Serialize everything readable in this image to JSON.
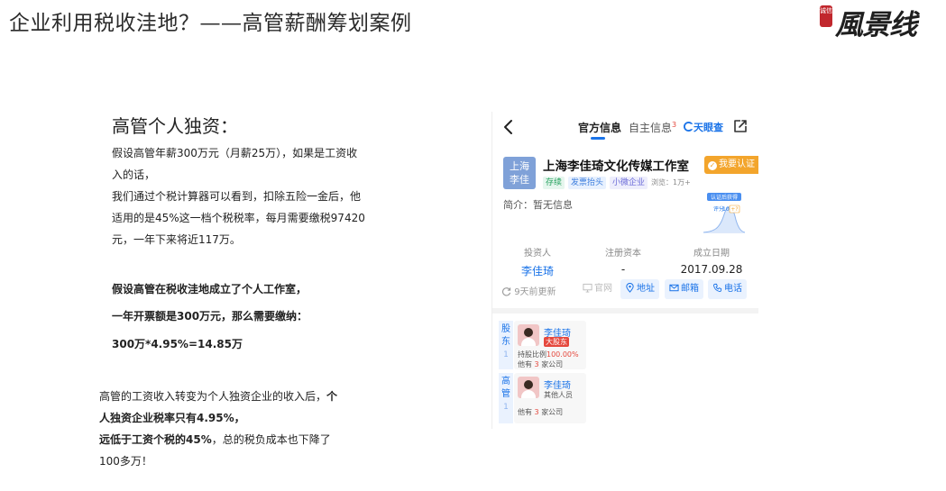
{
  "slide": {
    "title": "企业利用税收洼地？——高管薪酬筹划案例",
    "logo_text": "風景线",
    "logo_seal": "诚信"
  },
  "left": {
    "heading": "高管个人独资：",
    "para1": [
      "假设高管年薪300万元（月薪25万），如果是工资收",
      "入的话，",
      "我们通过个税计算器可以看到，扣除五险一金后，他",
      "适用的是45%这一档个税税率，每月需要缴税97420",
      "元，一年下来将近117万。"
    ],
    "para2": "假设高管在税收洼地成立了个人工作室，",
    "para3": "一年开票额是300万元，那么需要缴纳：",
    "para4": "300万*4.95%=14.85万"
  },
  "summary": {
    "line1_normal": "高管的工资收入转变为个人独资企业的收入后，",
    "line1_bold": "个",
    "line2": "人独资企业税率只有4.95%，",
    "line3_bold": "远低于工资个税的45%",
    "line3_normal": "，总的税负成本也下降了",
    "line4": "100多万！"
  },
  "phone": {
    "tab_official": "官方信息",
    "tab_self": "自主信息",
    "tab_self_badge": "3",
    "brand": "天眼查",
    "company_logo_line1": "上海",
    "company_logo_line2": "李佳",
    "company_name": "上海李佳琦文化传媒工作室",
    "verify_label": "我要认证",
    "tags": [
      "存续",
      "发票抬头",
      "小微企业"
    ],
    "views": "浏览：1万+",
    "intro": "简介：暂无信息",
    "chart_badge": "认证后获得",
    "chart_score_label": "评分",
    "chart_score_value": "10",
    "chart_score_plus": "+?",
    "stats": [
      {
        "label": "投资人",
        "value": "李佳琦"
      },
      {
        "label": "注册资本",
        "value": "-"
      },
      {
        "label": "成立日期",
        "value": "2017.09.28"
      }
    ],
    "updated": "9天前更新",
    "actions": [
      "官网",
      "地址",
      "邮箱",
      "电话"
    ],
    "side_tab1": [
      "股",
      "东"
    ],
    "side_tab1_count": "1",
    "side_tab2": [
      "高",
      "管"
    ],
    "side_tab2_count": "1",
    "shareholder": {
      "name": "李佳琦",
      "badge": "大股东",
      "ratio_label": "持股比例",
      "ratio_value": "100.00%",
      "companies_pre": "他有",
      "companies_count": "3",
      "companies_post": "家公司"
    },
    "executive": {
      "name": "李佳琦",
      "role": "其他人员",
      "companies_pre": "他有",
      "companies_count": "3",
      "companies_post": "家公司"
    }
  },
  "colors": {
    "accent_blue": "#1a73e8",
    "verify_orange": "#f3a52c",
    "danger_red": "#e5483d"
  }
}
